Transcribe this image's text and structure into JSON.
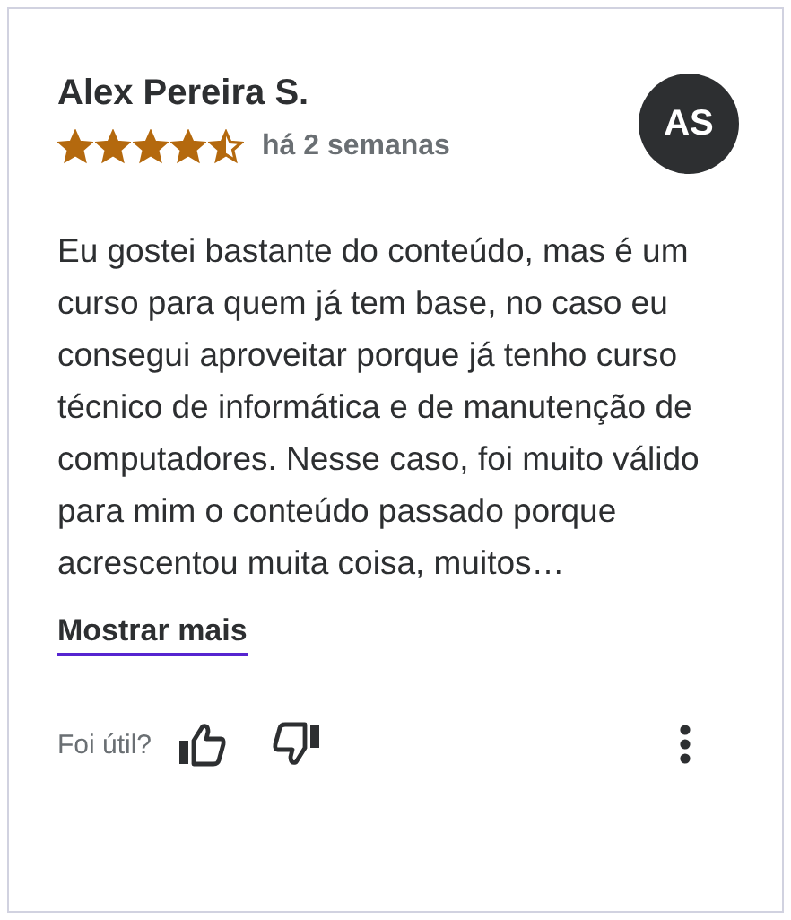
{
  "review": {
    "author": "Alex Pereira S.",
    "initials": "AS",
    "stars": 4.5,
    "time": "há 2 semanas",
    "text": "Eu gostei bastante do conteúdo, mas é um curso para quem já tem base, no caso eu consegui aproveitar porque já tenho curso técnico de informática e de manutenção de computadores. Nesse caso, foi muito válido para mim o conteúdo passado porque acrescentou muita coisa, muitos…",
    "show_more": "Mostrar mais",
    "helpful_prompt": "Foi útil?"
  }
}
